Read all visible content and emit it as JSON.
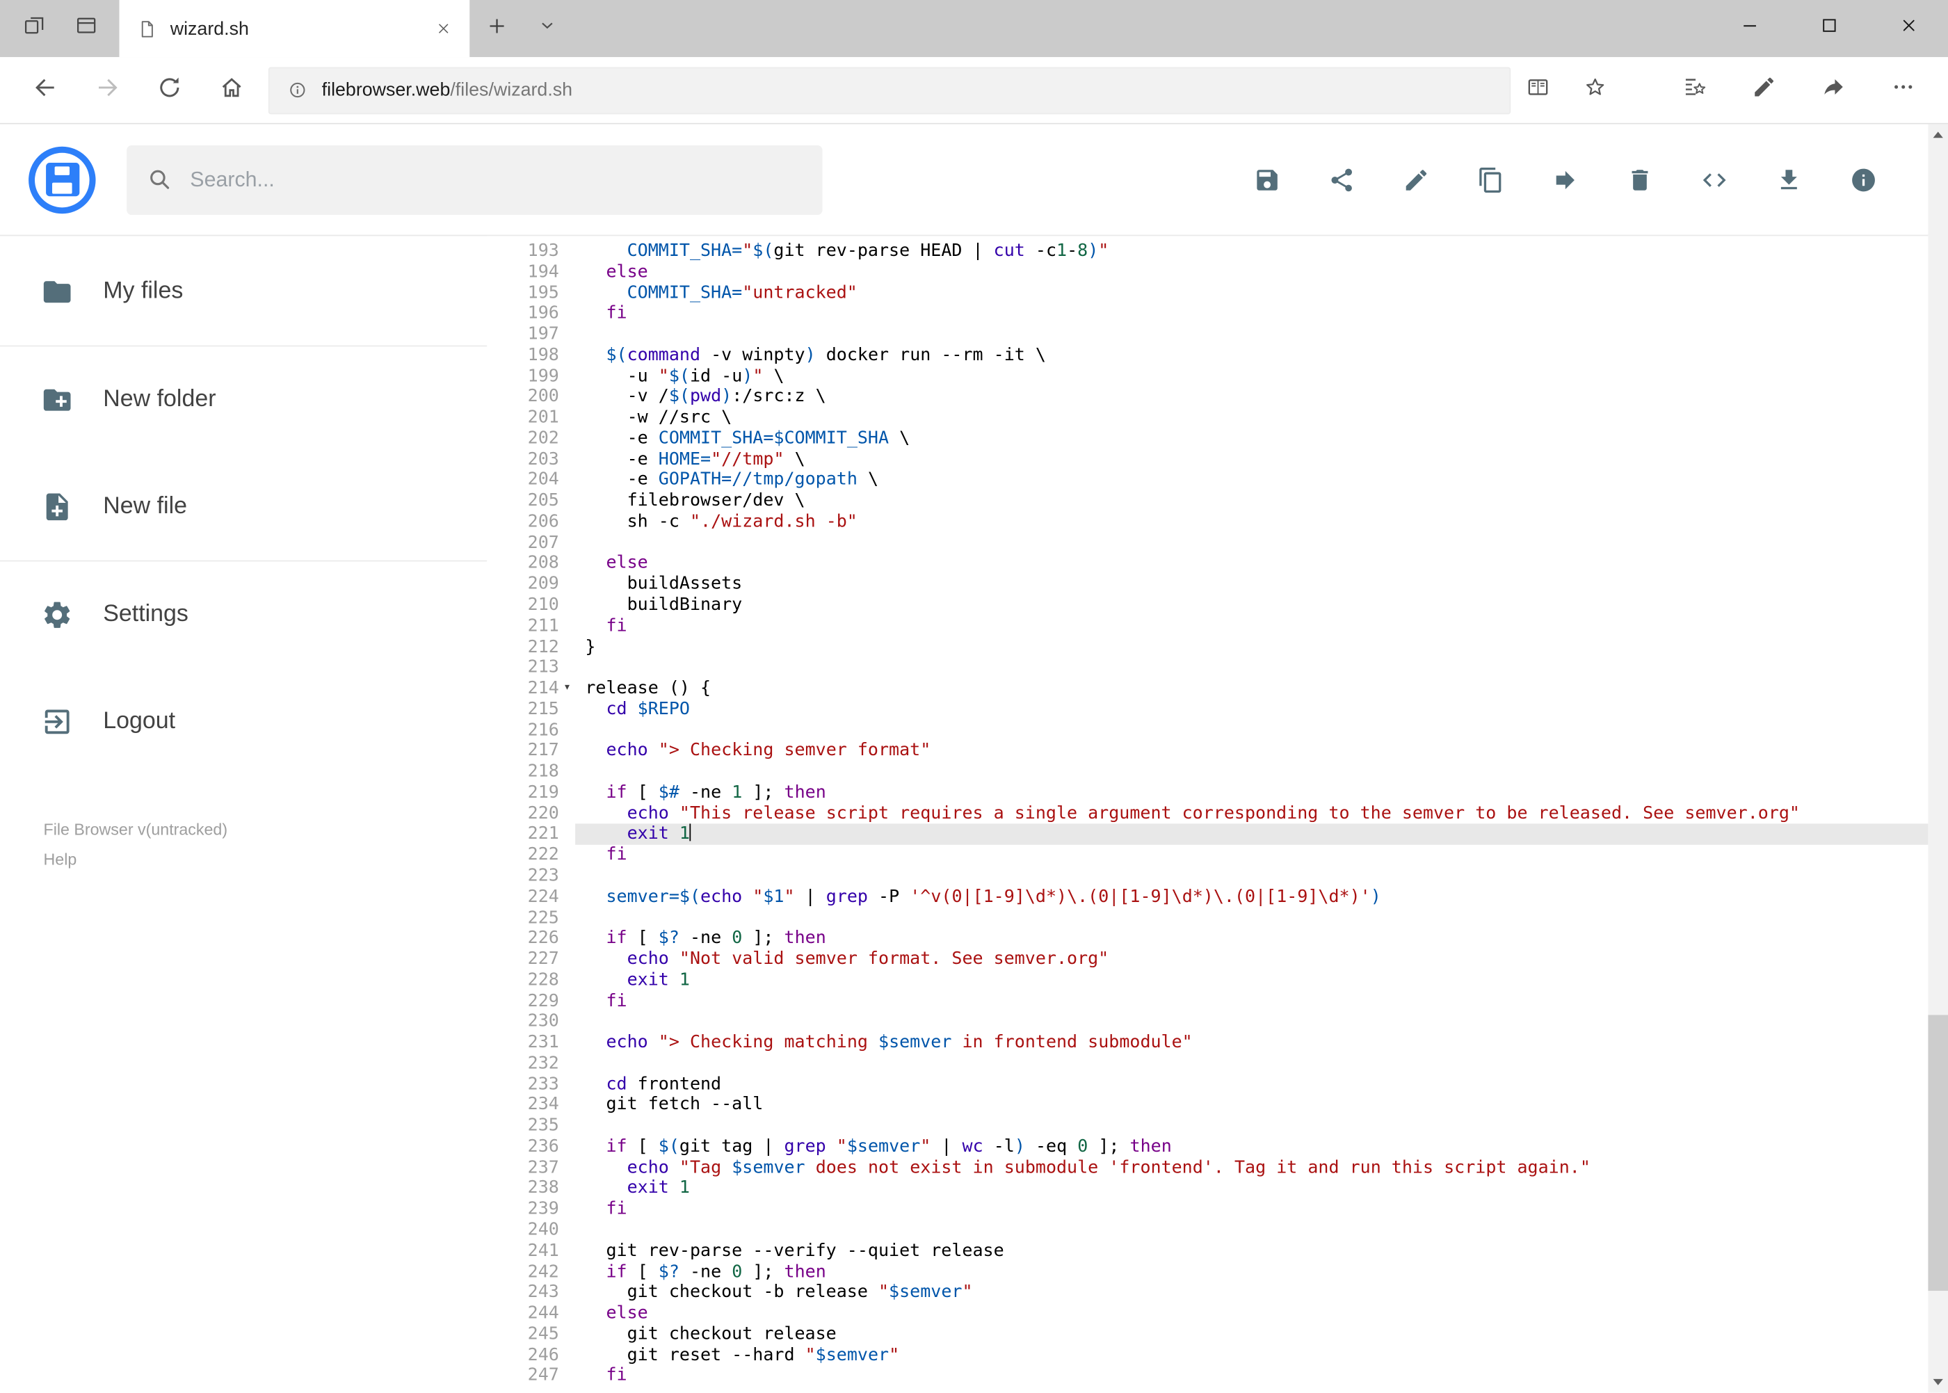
{
  "window": {
    "tab_title": "wizard.sh",
    "controls": [
      "minimize",
      "maximize",
      "close"
    ]
  },
  "browser": {
    "url_host": "filebrowser.web",
    "url_path": "/files/wizard.sh",
    "nav_icons": [
      "back-icon",
      "forward-icon",
      "refresh-icon",
      "home-icon"
    ],
    "right_icons": [
      "reading-view-icon",
      "favorite-star-icon",
      "hub-icon",
      "web-note-pen-icon",
      "share-icon",
      "more-icon"
    ]
  },
  "app": {
    "search_placeholder": "Search...",
    "toolbar_icons": [
      "save-icon",
      "share-icon",
      "rename-icon",
      "copy-icon",
      "move-icon",
      "delete-icon",
      "code-icon",
      "download-icon",
      "info-icon"
    ],
    "sidebar": {
      "items": [
        {
          "label": "My files",
          "icon": "folder-icon"
        },
        {
          "label": "New folder",
          "icon": "new-folder-icon"
        },
        {
          "label": "New file",
          "icon": "new-file-icon"
        },
        {
          "label": "Settings",
          "icon": "settings-icon"
        },
        {
          "label": "Logout",
          "icon": "logout-icon"
        }
      ],
      "version": "File Browser v(untracked)",
      "help": "Help"
    }
  },
  "editor": {
    "first_line_number": 193,
    "active_line_number": 221,
    "fold_marker_line": 214,
    "cursor_line": 221,
    "lines": [
      "    COMMIT_SHA=\"$(git rev-parse HEAD | cut -c1-8)\"",
      "  else",
      "    COMMIT_SHA=\"untracked\"",
      "  fi",
      "",
      "  $(command -v winpty) docker run --rm -it \\",
      "    -u \"$(id -u)\" \\",
      "    -v /$(pwd):/src:z \\",
      "    -w //src \\",
      "    -e COMMIT_SHA=$COMMIT_SHA \\",
      "    -e HOME=\"//tmp\" \\",
      "    -e GOPATH=//tmp/gopath \\",
      "    filebrowser/dev \\",
      "    sh -c \"./wizard.sh -b\"",
      "",
      "  else",
      "    buildAssets",
      "    buildBinary",
      "  fi",
      "}",
      "",
      "release () {",
      "  cd $REPO",
      "",
      "  echo \"> Checking semver format\"",
      "",
      "  if [ $# -ne 1 ]; then",
      "    echo \"This release script requires a single argument corresponding to the semver to be released. See semver.org\"",
      "    exit 1",
      "  fi",
      "",
      "  semver=$(echo \"$1\" | grep -P '^v(0|[1-9]\\d*)\\.(0|[1-9]\\d*)\\.(0|[1-9]\\d*)')",
      "",
      "  if [ $? -ne 0 ]; then",
      "    echo \"Not valid semver format. See semver.org\"",
      "    exit 1",
      "  fi",
      "",
      "  echo \"> Checking matching $semver in frontend submodule\"",
      "",
      "  cd frontend",
      "  git fetch --all",
      "",
      "  if [ $(git tag | grep \"$semver\" | wc -l) -eq 0 ]; then",
      "    echo \"Tag $semver does not exist in submodule 'frontend'. Tag it and run this script again.\"",
      "    exit 1",
      "  fi",
      "",
      "  git rev-parse --verify --quiet release",
      "  if [ $? -ne 0 ]; then",
      "    git checkout -b release \"$semver\"",
      "  else",
      "    git checkout release",
      "    git reset --hard \"$semver\"",
      "  fi"
    ]
  },
  "colors": {
    "accent_blue": "#2d7ff9",
    "keyword": "#770088",
    "string": "#aa1111",
    "variable": "#0055aa",
    "number": "#116644",
    "builtin": "#3300aa",
    "active_line_bg": "#e8e8e8"
  }
}
